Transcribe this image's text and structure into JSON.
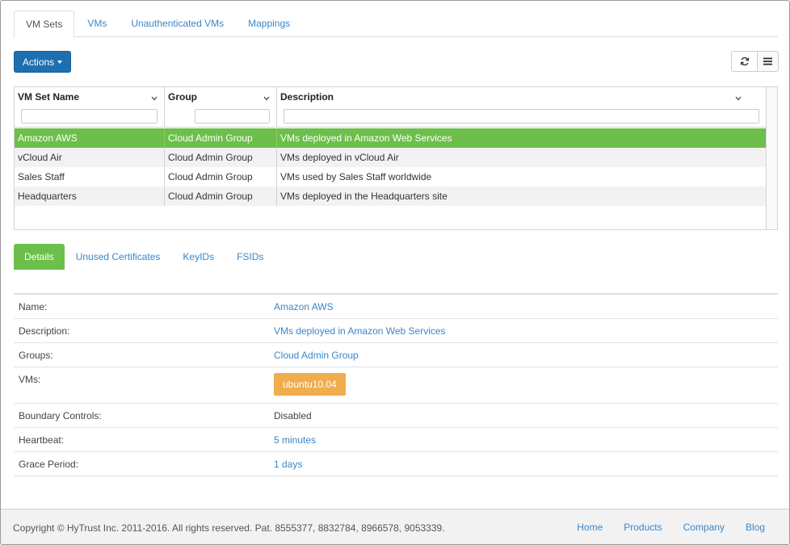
{
  "top_tabs": [
    {
      "label": "VM Sets",
      "active": true
    },
    {
      "label": "VMs",
      "active": false
    },
    {
      "label": "Unauthenticated VMs",
      "active": false
    },
    {
      "label": "Mappings",
      "active": false
    }
  ],
  "toolbar": {
    "actions_label": "Actions",
    "refresh_icon": "refresh-icon",
    "menu_icon": "list-menu-icon"
  },
  "grid": {
    "columns": [
      {
        "label": "VM Set Name"
      },
      {
        "label": "Group"
      },
      {
        "label": "Description"
      }
    ],
    "filters": [
      "",
      "",
      ""
    ],
    "rows": [
      {
        "name": "Amazon AWS",
        "group": "Cloud Admin Group",
        "description": "VMs deployed in Amazon Web Services",
        "selected": true
      },
      {
        "name": "vCloud Air",
        "group": "Cloud Admin Group",
        "description": "VMs deployed in vCloud Air",
        "selected": false
      },
      {
        "name": "Sales Staff",
        "group": "Cloud Admin Group",
        "description": "VMs used by Sales Staff worldwide",
        "selected": false
      },
      {
        "name": "Headquarters",
        "group": "Cloud Admin Group",
        "description": "VMs deployed in the Headquarters site",
        "selected": false
      }
    ]
  },
  "detail_tabs": [
    {
      "label": "Details",
      "active": true
    },
    {
      "label": "Unused Certificates",
      "active": false
    },
    {
      "label": "KeyIDs",
      "active": false
    },
    {
      "label": "FSIDs",
      "active": false
    }
  ],
  "details": {
    "name_label": "Name:",
    "name_value": "Amazon AWS",
    "description_label": "Description:",
    "description_value": "VMs deployed in Amazon Web Services",
    "groups_label": "Groups:",
    "groups_value": "Cloud Admin Group",
    "vms_label": "VMs:",
    "vms_value": "ubuntu10.04",
    "boundary_label": "Boundary Controls:",
    "boundary_value": "Disabled",
    "heartbeat_label": "Heartbeat:",
    "heartbeat_value": "5 minutes",
    "grace_label": "Grace Period:",
    "grace_value": "1 days"
  },
  "footer": {
    "copyright": "Copyright © HyTrust Inc. 2011-2016. All rights reserved. Pat. 8555377, 8832784, 8966578, 9053339.",
    "links": [
      "Home",
      "Products",
      "Company",
      "Blog"
    ]
  },
  "colors": {
    "accent_blue": "#1e6fb0",
    "link_blue": "#3a87c8",
    "selected_green": "#6cbf4b",
    "badge_orange": "#f0ad4e"
  }
}
